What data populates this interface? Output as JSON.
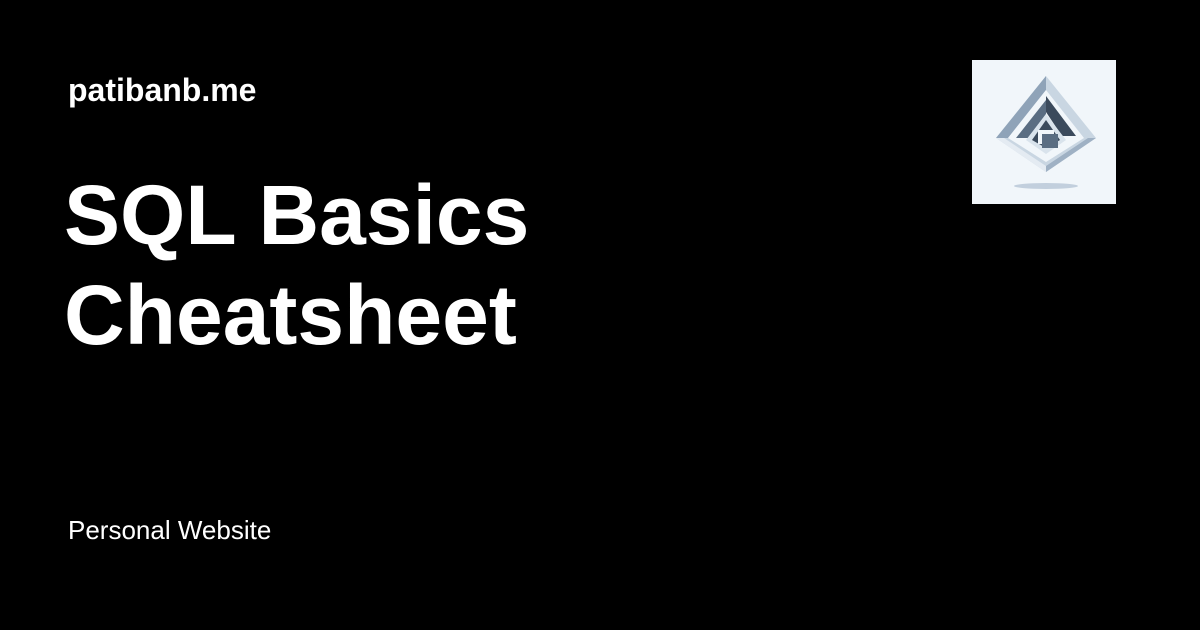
{
  "site": {
    "name": "patibanb.me"
  },
  "post": {
    "title_lines": [
      "SQL Basics",
      "Cheatsheet"
    ]
  },
  "footer": {
    "label": "Personal Website"
  },
  "logo": {
    "icon": "geometric-diamond-logo-icon"
  },
  "colors": {
    "background": "#000000",
    "text": "#ffffff",
    "logo_background": "#f1f6fa",
    "logo_dark": "#3b4a5c",
    "logo_light": "#aebfd0"
  }
}
